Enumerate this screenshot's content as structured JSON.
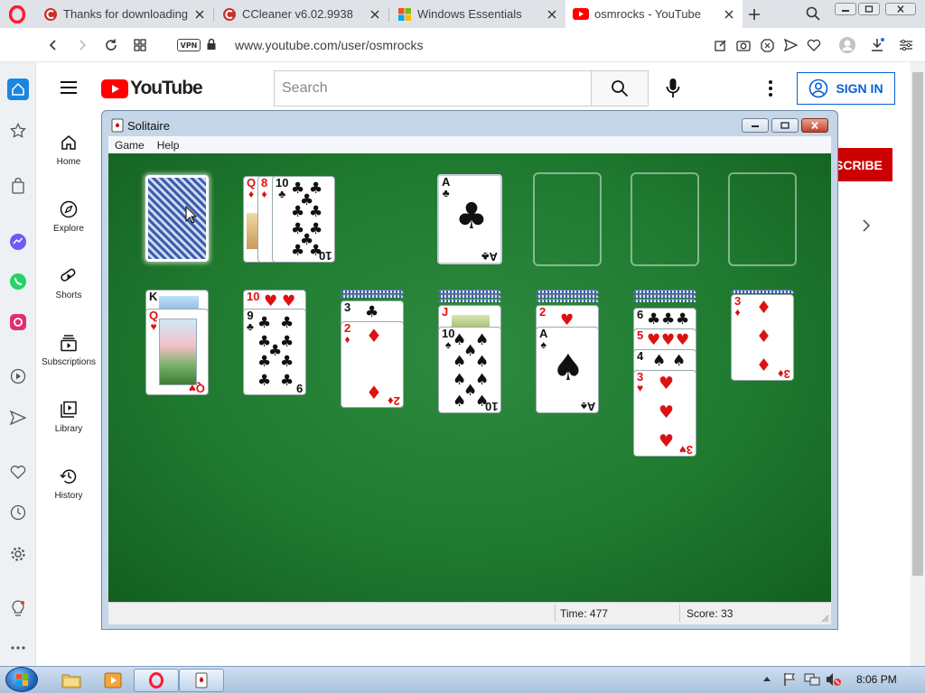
{
  "browser": {
    "tabs": [
      {
        "label": "Thanks for downloading C",
        "icon": "ccleaner-icon"
      },
      {
        "label": "CCleaner v6.02.9938",
        "icon": "ccleaner-icon"
      },
      {
        "label": "Windows Essentials",
        "icon": "windows-icon"
      },
      {
        "label": "osmrocks - YouTube",
        "icon": "youtube-icon",
        "active": true
      }
    ],
    "url": "www.youtube.com/user/osmrocks",
    "vpn_label": "VPN"
  },
  "youtube": {
    "logo_text": "YouTube",
    "search_placeholder": "Search",
    "signin_label": "SIGN IN",
    "subscribe_label": "SCRIBE",
    "nav": [
      {
        "label": "Home",
        "icon": "home-icon"
      },
      {
        "label": "Explore",
        "icon": "compass-icon"
      },
      {
        "label": "Shorts",
        "icon": "shorts-icon"
      },
      {
        "label": "Subscriptions",
        "icon": "subscriptions-icon"
      },
      {
        "label": "Library",
        "icon": "library-icon"
      },
      {
        "label": "History",
        "icon": "history-icon"
      }
    ]
  },
  "solitaire": {
    "title": "Solitaire",
    "menu": [
      "Game",
      "Help"
    ],
    "status": {
      "time_label": "Time:",
      "time_value": "477",
      "score_label": "Score:",
      "score_value": "33"
    },
    "waste": [
      {
        "rank": "Q",
        "suit": "♦"
      },
      {
        "rank": "8",
        "suit": "♦"
      },
      {
        "rank": "10",
        "suit": "♣"
      }
    ],
    "foundations": [
      {
        "rank": "A",
        "suit": "♣"
      }
    ],
    "tableau": [
      {
        "hidden": 0,
        "up": [
          {
            "rank": "K",
            "suit": "♠"
          },
          {
            "rank": "Q",
            "suit": "♥"
          }
        ]
      },
      {
        "hidden": 0,
        "up": [
          {
            "rank": "10",
            "suit": "♥"
          },
          {
            "rank": "9",
            "suit": "♣"
          }
        ]
      },
      {
        "hidden": 2,
        "up": [
          {
            "rank": "3",
            "suit": "♣"
          },
          {
            "rank": "2",
            "suit": "♦"
          }
        ]
      },
      {
        "hidden": 3,
        "up": [
          {
            "rank": "J",
            "suit": "♥"
          },
          {
            "rank": "10",
            "suit": "♠"
          }
        ]
      },
      {
        "hidden": 3,
        "up": [
          {
            "rank": "2",
            "suit": "♥"
          },
          {
            "rank": "A",
            "suit": "♠"
          }
        ]
      },
      {
        "hidden": 3,
        "up": [
          {
            "rank": "6",
            "suit": "♣"
          },
          {
            "rank": "5",
            "suit": "♥"
          },
          {
            "rank": "4",
            "suit": "♠"
          },
          {
            "rank": "3",
            "suit": "♥"
          }
        ]
      },
      {
        "hidden": 1,
        "up": [
          {
            "rank": "3",
            "suit": "♦"
          }
        ]
      }
    ]
  },
  "taskbar": {
    "time": "8:06 PM",
    "apps": [
      "file-explorer-icon",
      "media-player-icon",
      "opera-icon",
      "solitaire-icon"
    ]
  },
  "colors": {
    "felt": "#1f7a30",
    "youtube_red": "#ff0000",
    "opera_red": "#ff1b2d",
    "signin_blue": "#065fd4"
  }
}
